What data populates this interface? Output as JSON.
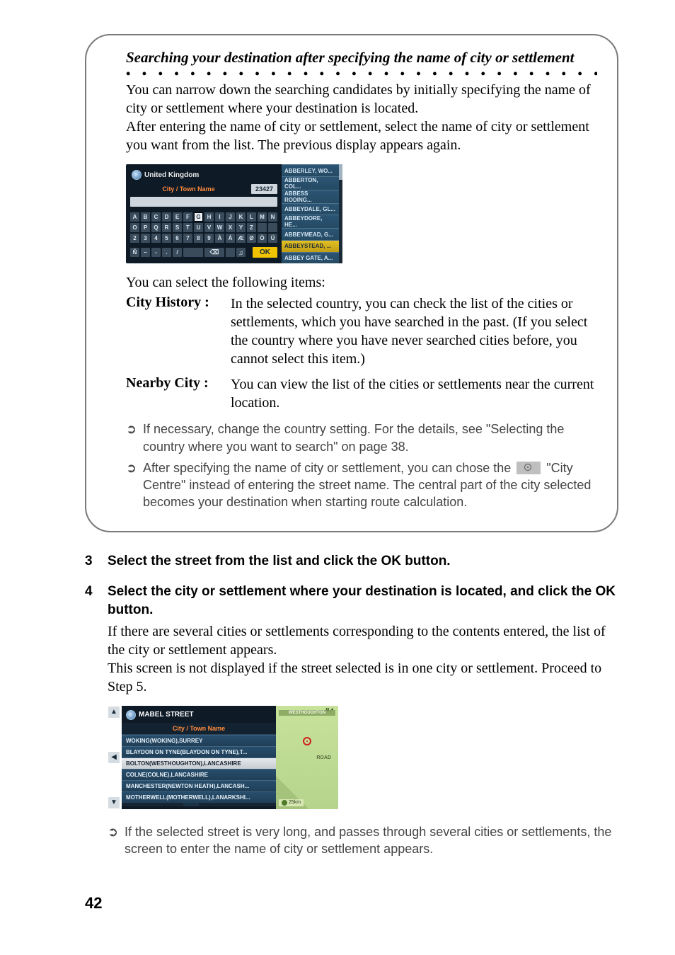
{
  "section": {
    "title": "Searching your destination after specifying the name of city or settlement",
    "intro1": "You can narrow down the searching candidates by initially specifying the name of city or settlement where your destination is located.",
    "intro2": "After entering the name of city or settlement, select the name of city or settlement you want from the list. The previous display appears again.",
    "select_following": "You can select the following items:",
    "items": {
      "city_history_label": "City History :",
      "city_history_desc": "In the selected country, you can check the list of the cities or settlements, which you have searched in the past. (If you select the country where you have never searched cities before, you cannot select this item.)",
      "nearby_city_label": "Nearby City :",
      "nearby_city_desc": "You can view the list of the cities or settlements near the current location."
    },
    "notes": {
      "n1": "If necessary, change the country setting. For the details, see \"Selecting the country where you want to search\" on page 38.",
      "n2a": "After specifying the name of city or settlement, you can chose the ",
      "n2b": " \"City Centre\" instead of entering the street name. The central part of the city selected becomes your destination when starting route calculation."
    }
  },
  "steps": {
    "s3": {
      "num": "3",
      "text": "Select the street from the list and click the OK button."
    },
    "s4": {
      "num": "4",
      "text": "Select the city or settlement where your destination is located, and click the OK button.",
      "body1": "If there are several cities or settlements corresponding to the contents entered, the list of the city or settlement appears.",
      "body2": "This screen is not displayed if the street selected is in one city or settlement. Proceed to Step 5."
    }
  },
  "bottom_note": "If the selected street is very long, and passes through several cities or settlements, the screen to enter the name of city or settlement appears.",
  "page_number": "42",
  "screen1": {
    "country": "United Kingdom",
    "field_label": "City / Town Name",
    "count": "23427",
    "ok": "OK",
    "row1": [
      "A",
      "B",
      "C",
      "D",
      "E",
      "F",
      "G",
      "H",
      "I",
      "J",
      "K",
      "L",
      "M",
      "N"
    ],
    "row2": [
      "O",
      "P",
      "Q",
      "R",
      "S",
      "T",
      "U",
      "V",
      "W",
      "X",
      "Y",
      "Z",
      "",
      ""
    ],
    "row3": [
      "2",
      "3",
      "4",
      "5",
      "6",
      "7",
      "8",
      "9",
      "À",
      "Á",
      "Æ",
      "Ø",
      "Ö",
      "Ü"
    ],
    "row4": [
      "Ñ",
      "–",
      "-",
      ".",
      "/",
      " ",
      "⌫",
      " ",
      "♫"
    ],
    "list": [
      "ABBERLEY, WO...",
      "ABBERTON, COL...",
      "ABBESS RODING...",
      "ABBEYDALE, GL...",
      "ABBEYDORE, HE...",
      "ABBEYMEAD, G...",
      "ABBEYSTEAD, ...",
      "ABBEY GATE, A..."
    ]
  },
  "screen2": {
    "title": "MABEL STREET",
    "header": "City / Town Name",
    "rows": [
      "WOKING(WOKING),SURREY",
      "BLAYDON ON TYNE(BLAYDON ON TYNE),T...",
      "BOLTON(WESTHOUGHTON),LANCASHIRE",
      "COLNE(COLNE),LANCASHIRE",
      "MANCHESTER(NEWTON HEATH),LANCASH...",
      "MOTHERWELL(MOTHERWELL),LANARKSHI..."
    ],
    "map": {
      "label": "WESTHOUGHTON",
      "road": "ROAD",
      "scale": "25km"
    }
  }
}
